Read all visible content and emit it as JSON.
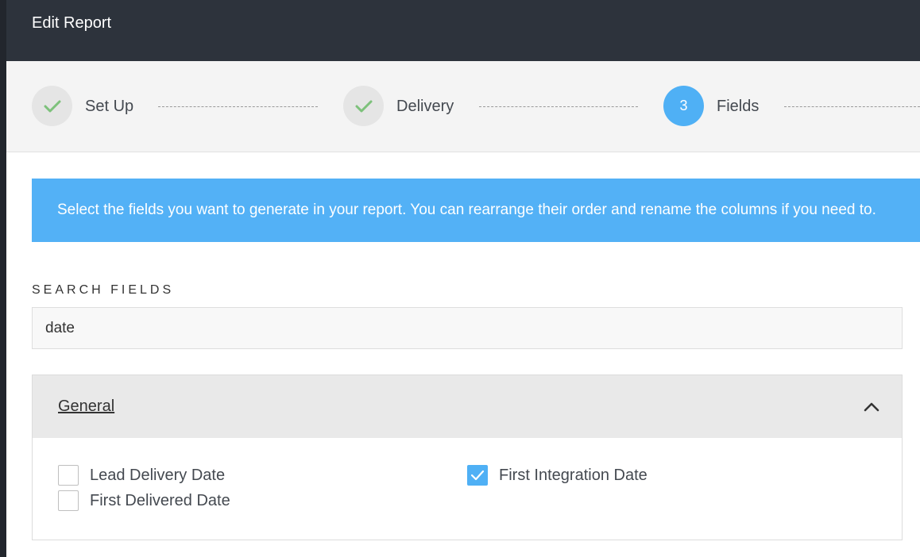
{
  "header": {
    "title": "Edit Report"
  },
  "stepper": {
    "steps": [
      {
        "label": "Set Up",
        "status": "complete",
        "icon": "check-icon"
      },
      {
        "label": "Delivery",
        "status": "complete",
        "icon": "check-icon"
      },
      {
        "label": "Fields",
        "status": "active",
        "number": "3"
      }
    ]
  },
  "banner": {
    "text": "Select the fields you want to generate in your report. You can rearrange their order and rename the columns if you need to."
  },
  "search": {
    "label": "SEARCH FIELDS",
    "value": "date"
  },
  "section": {
    "title": "General",
    "collapse_icon": "chevron-up-icon",
    "fields": [
      {
        "label": "Lead Delivery Date",
        "checked": false
      },
      {
        "label": "First Delivered Date",
        "checked": false
      },
      {
        "label": "First Integration Date",
        "checked": true
      }
    ]
  },
  "colors": {
    "header_bg": "#2d333c",
    "accent": "#53b1f6",
    "check_green": "#7dc17b",
    "stepper_bg": "#f4f4f4"
  }
}
